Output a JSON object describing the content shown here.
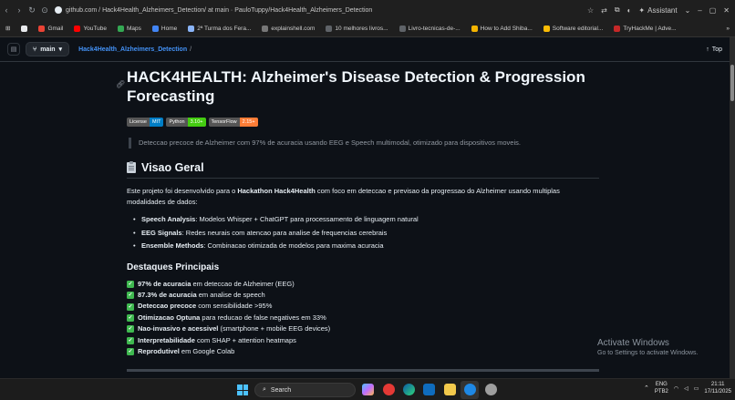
{
  "browser": {
    "url": "github.com / Hack4Health_Alzheimers_Detection/ at main · PauloTuppy/Hack4Health_Alzheimers_Detection",
    "assistant_label": "Assistant"
  },
  "bookmarks": [
    {
      "label": "Gmail",
      "color": "#ea4335"
    },
    {
      "label": "YouTube",
      "color": "#ff0000"
    },
    {
      "label": "Maps",
      "color": "#34a853"
    },
    {
      "label": "Home",
      "color": "#4285f4"
    },
    {
      "label": "2ª Turma dos Fera...",
      "color": "#8ab4f8"
    },
    {
      "label": "explainshell.com",
      "color": "#777777"
    },
    {
      "label": "10 melhores livros...",
      "color": "#5f6368"
    },
    {
      "label": "Livro-tecnicas-de-...",
      "color": "#5f6368"
    },
    {
      "label": "How to Add Shiba...",
      "color": "#f4b400"
    },
    {
      "label": "Software editorial...",
      "color": "#fbbc05"
    },
    {
      "label": "TryHackMe | Adve...",
      "color": "#c62828"
    }
  ],
  "repo_header": {
    "branch": "main",
    "breadcrumb": "Hack4Health_Alzheimers_Detection",
    "breadcrumb_sep": "/",
    "top_label": "Top"
  },
  "readme": {
    "title": "HACK4HEALTH: Alzheimer's Disease Detection & Progression Forecasting",
    "badges": [
      {
        "label": "License",
        "value": "MIT",
        "color": "#007ec6"
      },
      {
        "label": "Python",
        "value": "3.10+",
        "color": "#4c1"
      },
      {
        "label": "TensorFlow",
        "value": "2.15+",
        "color": "#fe7d37"
      }
    ],
    "quote": "Deteccao precoce de Alzheimer com 97% de acuracia usando EEG e Speech multimodal, otimizado para dispositivos moveis.",
    "section_title": "Visao Geral",
    "intro_pre": "Este projeto foi desenvolvido para o ",
    "intro_bold": "Hackathon Hack4Health",
    "intro_post": " com foco em deteccao e previsao da progressao do Alzheimer usando multiplas modalidades de dados:",
    "features": [
      {
        "bold": "Speech Analysis",
        "text": ": Modelos Whisper + ChatGPT para processamento de linguagem natural"
      },
      {
        "bold": "EEG Signals",
        "text": ": Redes neurais com atencao para analise de frequencias cerebrais"
      },
      {
        "bold": "Ensemble Methods",
        "text": ": Combinacao otimizada de modelos para maxima acuracia"
      }
    ],
    "highlights_title": "Destaques Principais",
    "highlights": [
      {
        "bold": "97% de acuracia",
        "text": " em deteccao de Alzheimer (EEG)"
      },
      {
        "bold": "87.3% de acuracia",
        "text": " em analise de speech"
      },
      {
        "bold": "Deteccao precoce",
        "text": " com sensibilidade >95%"
      },
      {
        "bold": "Otimizacao Optuna",
        "text": " para reducao de false negatives em 33%"
      },
      {
        "bold": "Nao-invasivo e acessivel",
        "text": " (smartphone + mobile EEG devices)"
      },
      {
        "bold": "Interpretabilidade",
        "text": " com SHAP + attention heatmaps"
      },
      {
        "bold": "Reprodutivel",
        "text": " em Google Colab"
      }
    ]
  },
  "watermark": {
    "line1": "Activate Windows",
    "line2": "Go to Settings to activate Windows."
  },
  "taskbar": {
    "search_placeholder": "Search",
    "lang_line1": "ENG",
    "lang_line2": "PTB2",
    "time": "21:11",
    "date": "17/11/2025"
  }
}
